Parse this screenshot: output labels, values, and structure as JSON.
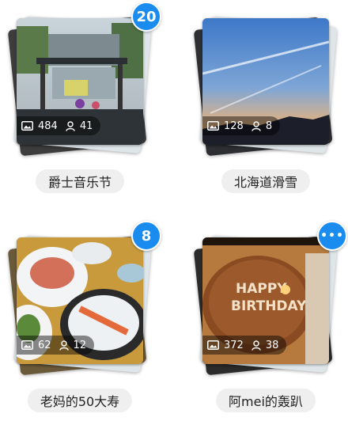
{
  "albums": [
    {
      "title": "爵士音乐节",
      "photos": "484",
      "members": "41",
      "badge": "20"
    },
    {
      "title": "北海道滑雪",
      "photos": "128",
      "members": "8",
      "badge": ""
    },
    {
      "title": "老妈的50大寿",
      "photos": "62",
      "members": "12",
      "badge": "8"
    },
    {
      "title": "阿mei的轰趴",
      "photos": "372",
      "members": "38",
      "badge": "•••"
    }
  ],
  "colors": {
    "badge": "#1a8cf0",
    "pill": "#efefef",
    "stats_overlay": "rgba(0,0,0,0.45)"
  },
  "icons": {
    "photo_count": "image-icon",
    "member_count": "person-icon",
    "more": "more-dots-icon"
  }
}
